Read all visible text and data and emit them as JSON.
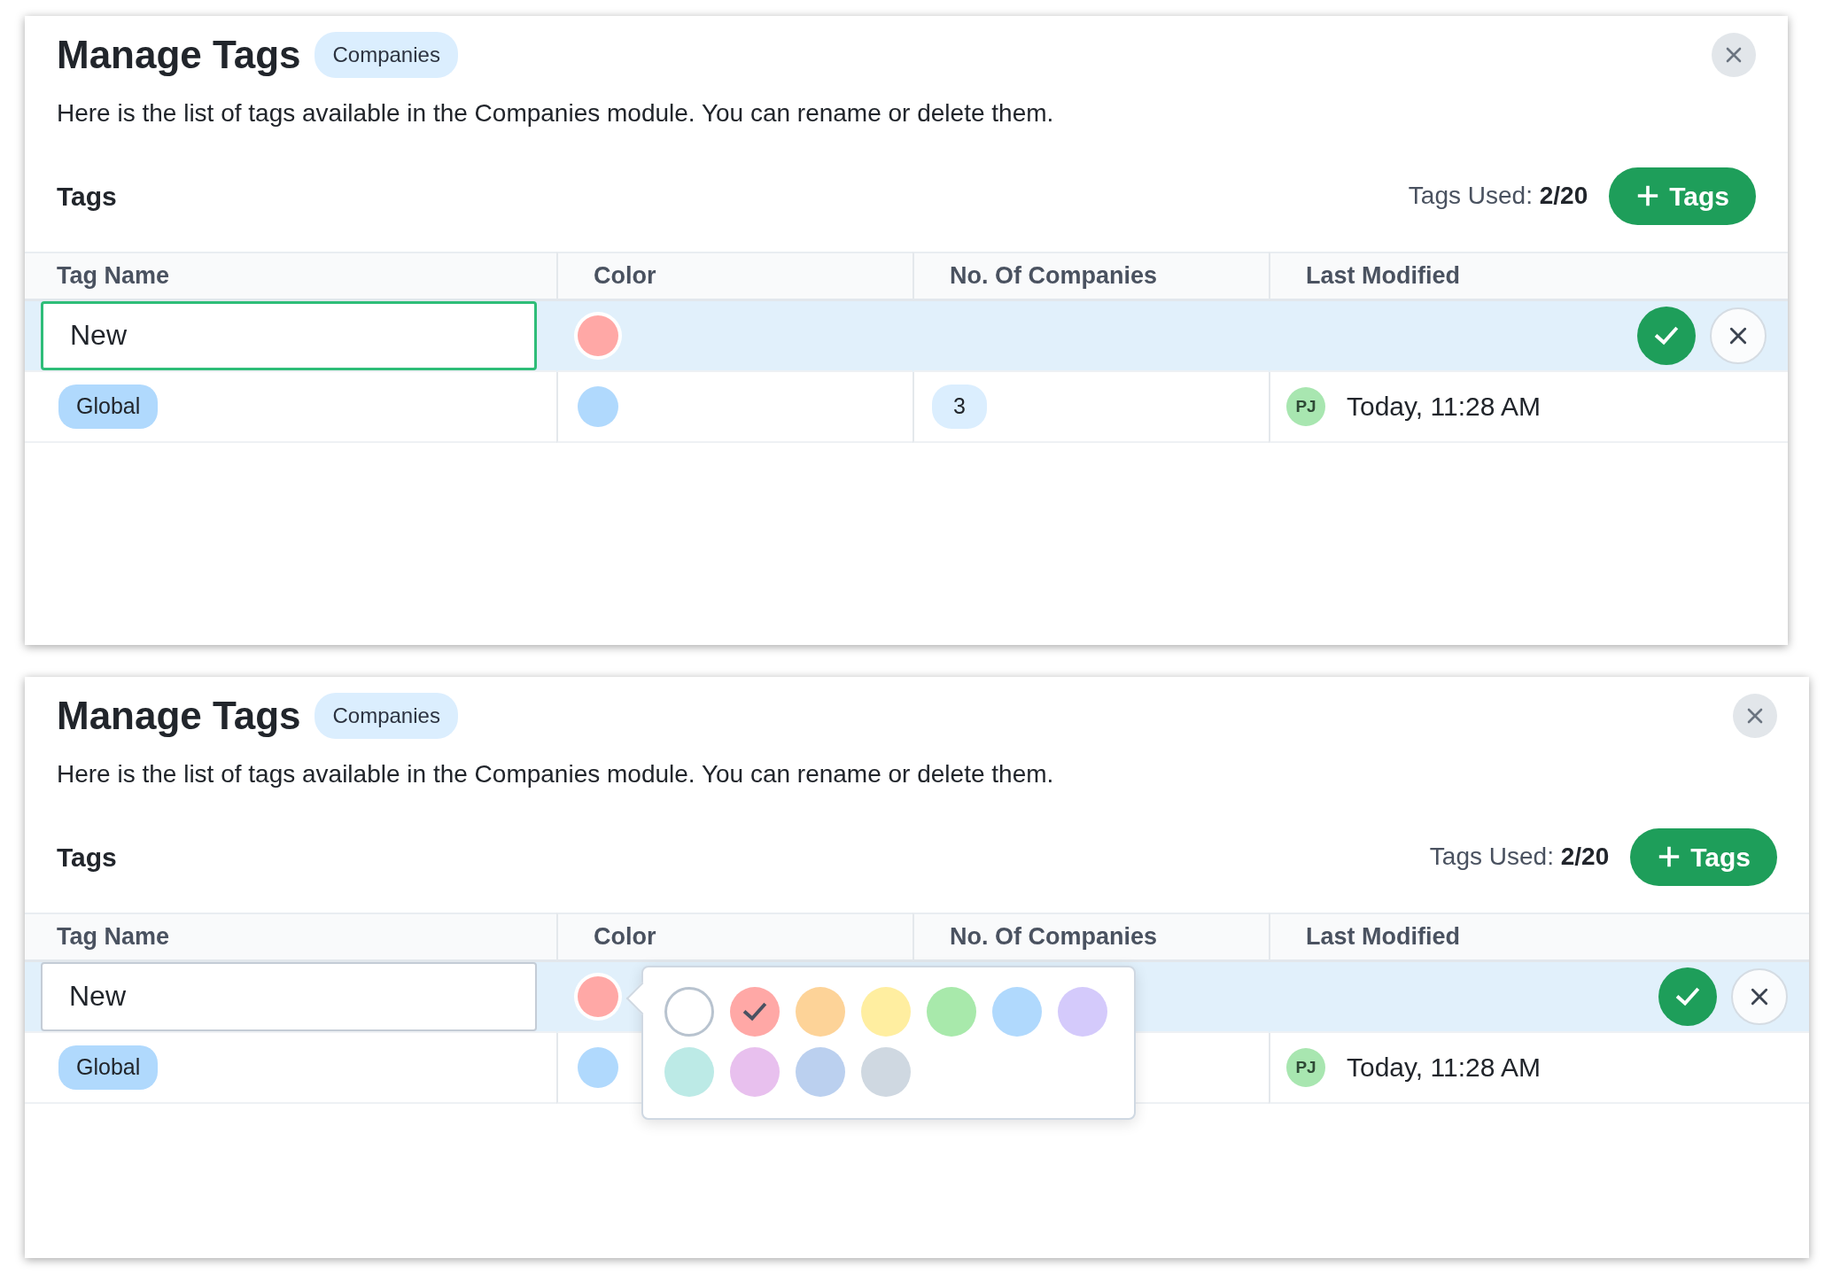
{
  "panels": [
    {
      "title": "Manage Tags",
      "module_badge": "Companies",
      "description": "Here is the list of tags available in the Companies module. You can rename or delete them.",
      "section_title": "Tags",
      "tags_used_label": "Tags Used:",
      "tags_used_value": "2/20",
      "add_button": "Tags",
      "columns": [
        "Tag Name",
        "Color",
        "No. Of Companies",
        "Last Modified"
      ],
      "rows": [
        {
          "kind": "edit",
          "value": "New",
          "focused": true,
          "color": "#ffa8a6"
        },
        {
          "kind": "tag",
          "name": "Global",
          "color": "#b0d9fd",
          "count": "3",
          "avatar": "PJ",
          "modified": "Today, 11:28 AM"
        }
      ]
    },
    {
      "title": "Manage Tags",
      "module_badge": "Companies",
      "description": "Here is the list of tags available in the Companies module. You can rename or delete them.",
      "section_title": "Tags",
      "tags_used_label": "Tags Used:",
      "tags_used_value": "2/20",
      "add_button": "Tags",
      "columns": [
        "Tag Name",
        "Color",
        "No. Of Companies",
        "Last Modified"
      ],
      "rows": [
        {
          "kind": "edit",
          "value": "New",
          "focused": false,
          "color": "#ffa8a6"
        },
        {
          "kind": "tag",
          "name": "Global",
          "color": "#b0d9fd",
          "avatar": "PJ",
          "modified": "Today, 11:28 AM"
        }
      ],
      "picker": {
        "swatches": [
          {
            "color": "#ffffff",
            "selected": false
          },
          {
            "color": "#ffa8a6",
            "selected": true
          },
          {
            "color": "#fdd398",
            "selected": false
          },
          {
            "color": "#ffeea0",
            "selected": false
          },
          {
            "color": "#a8e9ab",
            "selected": false
          },
          {
            "color": "#b0d9fd",
            "selected": false
          },
          {
            "color": "#d4cafb",
            "selected": false
          },
          {
            "color": "#bceae6",
            "selected": false
          },
          {
            "color": "#e8c0ee",
            "selected": false
          },
          {
            "color": "#bbd0ef",
            "selected": false
          },
          {
            "color": "#cfd8e1",
            "selected": false
          }
        ]
      }
    }
  ]
}
